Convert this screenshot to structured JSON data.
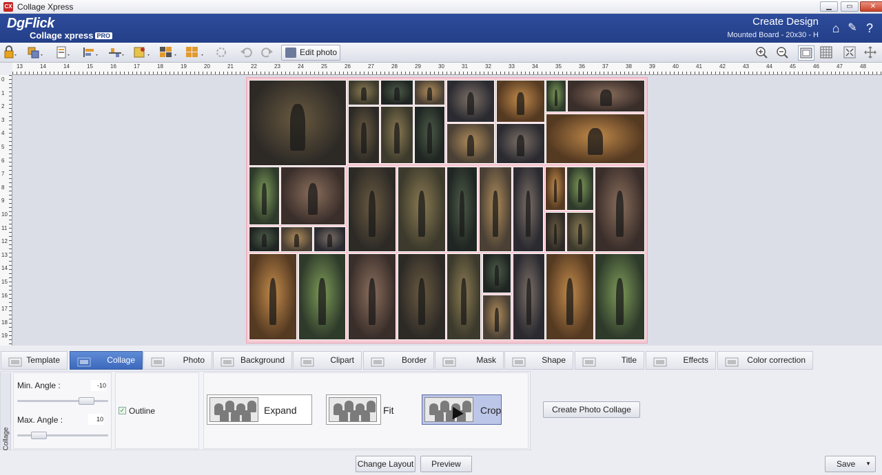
{
  "window": {
    "title": "Collage Xpress",
    "app_icon_text": "CX",
    "minimize": "▁",
    "restore": "▭",
    "close": "✕"
  },
  "header": {
    "logo_main": "DgFlick",
    "logo_sub": "Collage xpress",
    "logo_badge": "PRO",
    "title": "Create Design",
    "subtitle": "Mounted Board - 20x30 - H",
    "home_icon": "⌂",
    "tools_icon": "✎",
    "help_icon": "?"
  },
  "toolbar": {
    "edit_photo_label": "Edit photo",
    "zoom_in": "⊕",
    "zoom_out": "⊖",
    "icons": [
      "lock-icon",
      "layers-icon",
      "page-icon",
      "align-icon",
      "distribute-icon",
      "arrange-icon",
      "grid-icon",
      "layout-icon",
      "rotate-icon",
      "undo-icon",
      "redo-icon"
    ]
  },
  "ruler": {
    "h_labels": [
      "13",
      "14",
      "14",
      "15",
      "16",
      "17",
      "18",
      "19",
      "20",
      "21",
      "22",
      "23",
      "24",
      "25",
      "26",
      "27",
      "28",
      "29",
      "30",
      "31",
      "32",
      "33",
      "34",
      "35",
      "36",
      "37",
      "38",
      "39",
      "40",
      "41",
      "42",
      "43",
      "44",
      "45",
      "46",
      "47",
      "48"
    ],
    "v_labels": [
      "0",
      "1",
      "2",
      "3",
      "4",
      "5",
      "6",
      "7",
      "8",
      "9",
      "10",
      "11",
      "12",
      "13",
      "14",
      "15",
      "16",
      "17",
      "18",
      "19"
    ]
  },
  "tabs": [
    {
      "label": "Template",
      "active": false
    },
    {
      "label": "Collage",
      "active": true
    },
    {
      "label": "Photo",
      "active": false
    },
    {
      "label": "Background",
      "active": false
    },
    {
      "label": "Clipart",
      "active": false
    },
    {
      "label": "Border",
      "active": false
    },
    {
      "label": "Mask",
      "active": false
    },
    {
      "label": "Shape",
      "active": false
    },
    {
      "label": "Title",
      "active": false
    },
    {
      "label": "Effects",
      "active": false
    },
    {
      "label": "Color correction",
      "active": false
    }
  ],
  "panel": {
    "side_label": "Collage",
    "min_angle_label": "Min. Angle :",
    "min_angle_value": "-10",
    "min_angle_level": 0.82,
    "max_angle_label": "Max. Angle :",
    "max_angle_value": "10",
    "max_angle_level": 0.18,
    "outline_label": "Outline",
    "outline_checked": true,
    "modes": [
      {
        "label": "Expand",
        "selected": false
      },
      {
        "label": "Fit",
        "selected": false
      },
      {
        "label": "Crop",
        "selected": true
      }
    ],
    "create_button": "Create Photo Collage"
  },
  "footer": {
    "change_layout": "Change Layout",
    "preview": "Preview",
    "save": "Save"
  },
  "colors": {
    "header_bg": "#2d4c9c",
    "active_tab": "#4f7cca",
    "board_border": "#f6c8d2"
  }
}
